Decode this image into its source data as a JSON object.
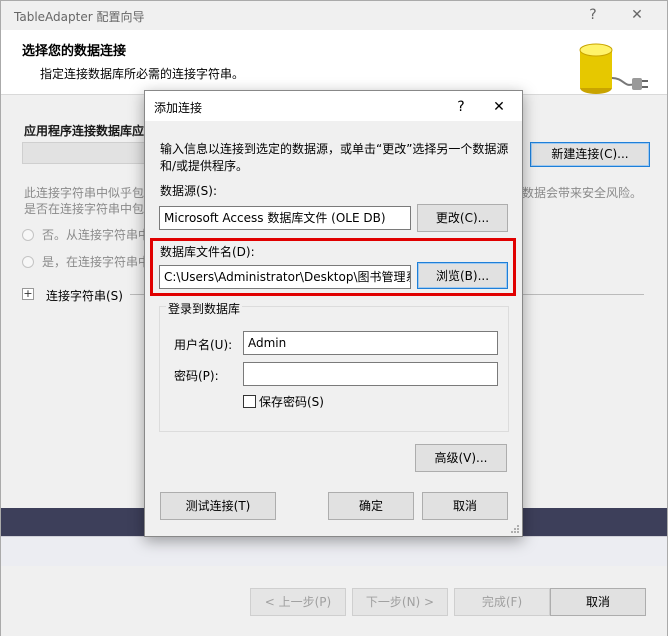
{
  "outer": {
    "title": "TableAdapter 配置向导",
    "help_glyph": "?",
    "close_glyph": "✕",
    "header_title": "选择您的数据连接",
    "header_subtitle": "指定连接数据库所必需的连接字符串。",
    "connection_label": "应用程序连接数据库应",
    "new_connection_button": "新建连接(C)...",
    "warning_left_1": "此连接字符串中似乎包",
    "warning_left_2": "是否在连接字符串中包",
    "warning_right": "数据会带来安全风险。",
    "radio_no": "否。从连接字符串中",
    "radio_yes": "是，在连接字符串中包",
    "expander_glyph": "+",
    "connection_string_label": "连接字符串(S)",
    "buttons": {
      "prev": "< 上一步(P)",
      "next": "下一步(N) >",
      "finish": "完成(F)",
      "cancel": "取消"
    }
  },
  "dialog": {
    "title": "添加连接",
    "help_glyph": "?",
    "close_glyph": "✕",
    "description_line1": "输入信息以连接到选定的数据源，或单击“更改”选择另一个数据源",
    "description_line2": "和/或提供程序。",
    "datasource_label": "数据源(S):",
    "datasource_value": "Microsoft Access 数据库文件 (OLE DB)",
    "change_button": "更改(C)...",
    "file_label": "数据库文件名(D):",
    "file_value": "C:\\Users\\Administrator\\Desktop\\图书管理系",
    "browse_button": "浏览(B)...",
    "login_group": "登录到数据库",
    "username_label": "用户名(U):",
    "username_value": "Admin",
    "password_label": "密码(P):",
    "password_value": "",
    "save_password_label": "保存密码(S)",
    "advanced_button": "高级(V)...",
    "test_button": "测试连接(T)",
    "ok_button": "确定",
    "cancel_button": "取消"
  },
  "colors": {
    "highlight": "#e00000",
    "focus_border": "#1e7fd8",
    "band": "#3d3f5a"
  },
  "icons": {
    "header": "database-plug-icon",
    "resize": "resize-grip-icon"
  }
}
